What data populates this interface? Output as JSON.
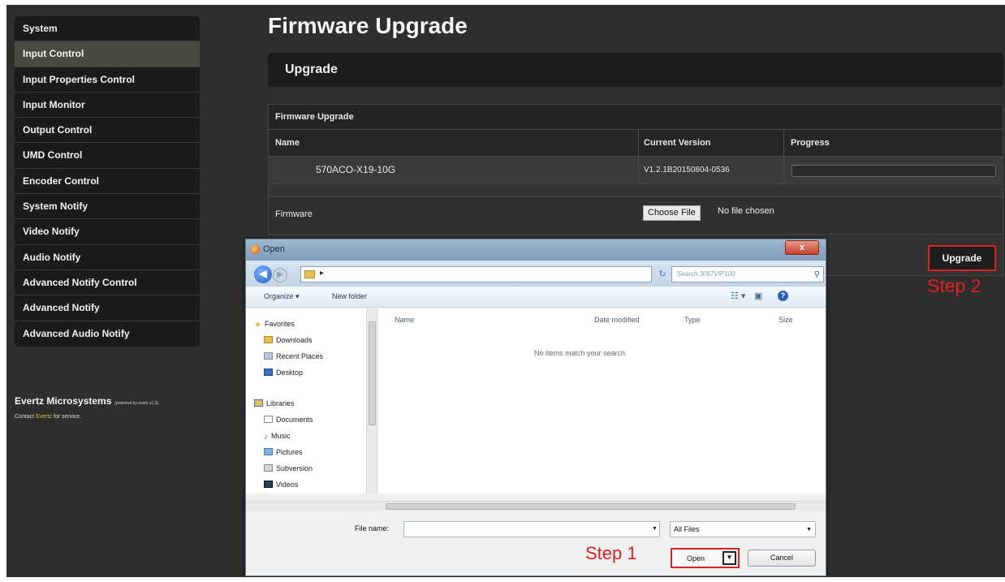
{
  "sidebar": {
    "items": [
      {
        "label": "System",
        "active": false
      },
      {
        "label": "Input Control",
        "active": true
      },
      {
        "label": "Input Properties Control",
        "active": false
      },
      {
        "label": "Input Monitor",
        "active": false
      },
      {
        "label": "Output Control",
        "active": false
      },
      {
        "label": "UMD Control",
        "active": false
      },
      {
        "label": "Encoder Control",
        "active": false
      },
      {
        "label": "System Notify",
        "active": false
      },
      {
        "label": "Video Notify",
        "active": false
      },
      {
        "label": "Audio Notify",
        "active": false
      },
      {
        "label": "Advanced Notify Control",
        "active": false
      },
      {
        "label": "Advanced Notify",
        "active": false
      },
      {
        "label": "Advanced Audio Notify",
        "active": false
      }
    ]
  },
  "footer": {
    "brand": "Evertz Microsystems",
    "powered": "(powered by eweb v1.3).",
    "contact_prefix": "Contact",
    "contact_link": "Evertz",
    "contact_suffix": "for service."
  },
  "main": {
    "title": "Firmware Upgrade",
    "section": "Upgrade",
    "panel_title": "Firmware Upgrade",
    "columns": {
      "name": "Name",
      "version": "Current Version",
      "progress": "Progress"
    },
    "row": {
      "name": "570ACO-X19-10G",
      "version": "V1.2.1B20150804-0536",
      "progress": 0
    },
    "firmware_label": "Firmware",
    "choose_file": "Choose File",
    "no_file": "No file chosen",
    "upgrade_button": "Upgrade",
    "step2": "Step 2"
  },
  "dialog": {
    "title": "Open",
    "close": "x",
    "search_placeholder": "Search 3067VIP100",
    "toolbar": {
      "organize": "Organize ▾",
      "new_folder": "New folder"
    },
    "nav": {
      "favorites": "Favorites",
      "downloads": "Downloads",
      "recent": "Recent Places",
      "desktop": "Desktop",
      "libraries": "Libraries",
      "documents": "Documents",
      "music": "Music",
      "pictures": "Pictures",
      "subversion": "Subversion",
      "videos": "Videos"
    },
    "columns": {
      "name": "Name",
      "date": "Date modified",
      "type": "Type",
      "size": "Size"
    },
    "empty": "No items match your search.",
    "file_name_label": "File name:",
    "file_name_value": "",
    "filter": "All Files",
    "open": "Open",
    "cancel": "Cancel",
    "step1": "Step 1"
  },
  "colors": {
    "accent_red": "#e02020",
    "background": "#2e2e2e",
    "sidebar": "#1b1b1b",
    "link_yellow": "#d8c13a"
  }
}
